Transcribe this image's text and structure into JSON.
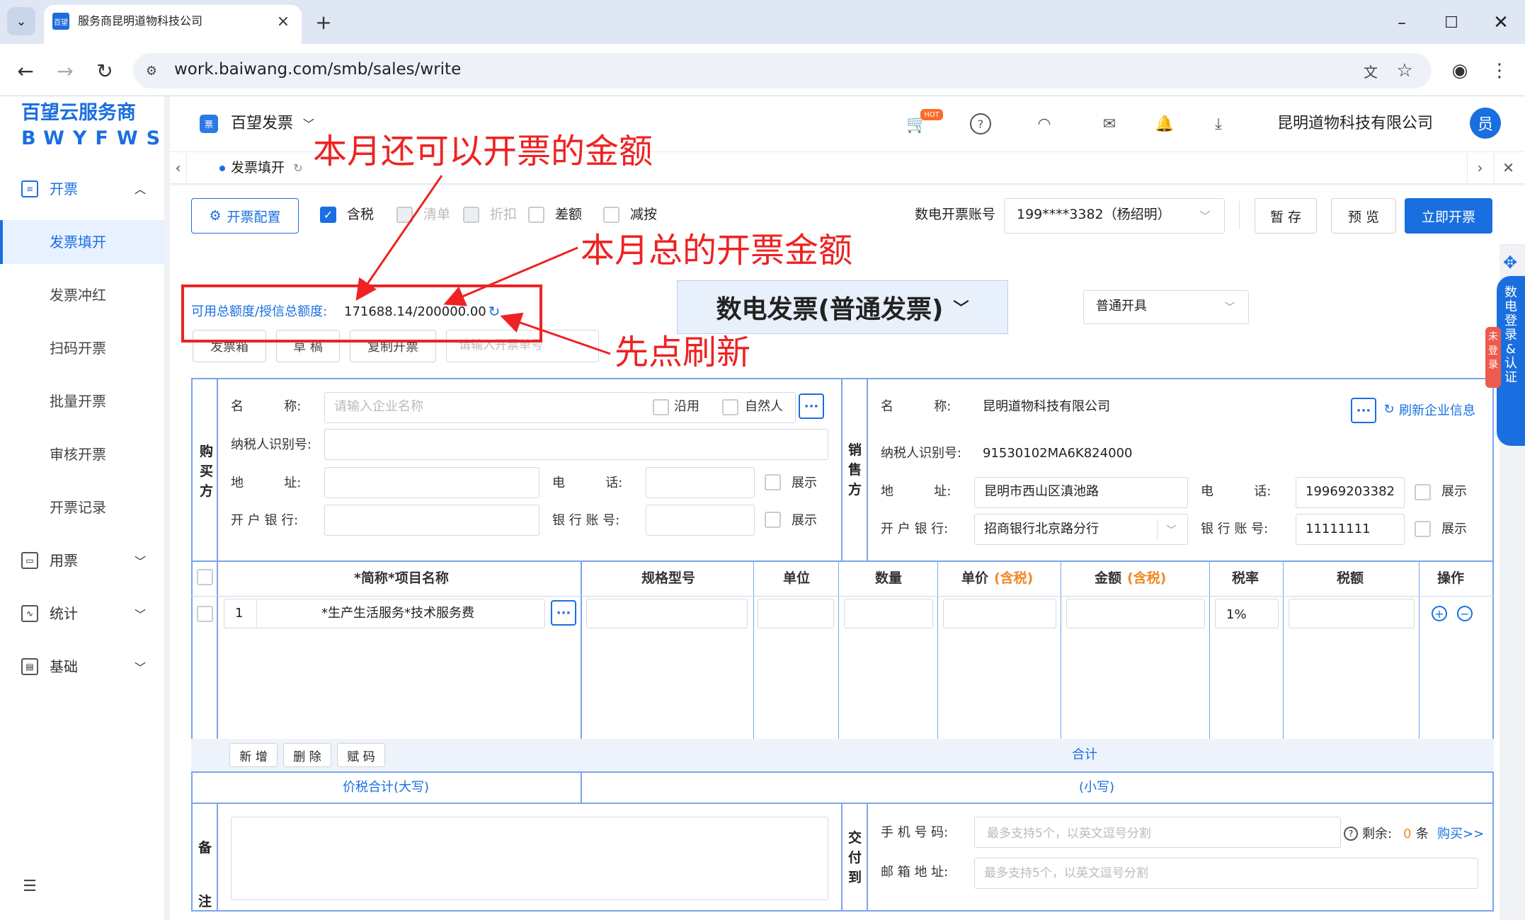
{
  "browser": {
    "tab_title": "服务商昆明道物科技公司",
    "tab_logo": "百望",
    "url": "work.baiwang.com/smb/sales/write"
  },
  "brand": {
    "line1": "百望云服务商",
    "line2": "BWYFWS"
  },
  "sidebar": {
    "items": [
      {
        "label": "开票",
        "icon": "invoice-icon"
      },
      {
        "label": "发票填开",
        "active": true
      },
      {
        "label": "发票冲红"
      },
      {
        "label": "扫码开票"
      },
      {
        "label": "批量开票"
      },
      {
        "label": "审核开票"
      },
      {
        "label": "开票记录"
      },
      {
        "label": "用票",
        "icon": "ticket-icon"
      },
      {
        "label": "统计",
        "icon": "chart-icon"
      },
      {
        "label": "基础",
        "icon": "base-icon"
      }
    ]
  },
  "header": {
    "app_name": "百望发票",
    "hot_badge": "HOT",
    "company": "昆明道物科技有限公司",
    "avatar": "员"
  },
  "page_tab": {
    "label": "发票填开"
  },
  "toolbar": {
    "config_label": "开票配置",
    "opt_tax": "含税",
    "opt_list": "清单",
    "opt_discount": "折扣",
    "opt_diff": "差额",
    "opt_reduce": "减按",
    "account_label": "数电开票账号",
    "account_value": "199****3382（杨绍明）",
    "save_label": "暂 存",
    "preview_label": "预 览",
    "issue_label": "立即开票"
  },
  "quota": {
    "label": "可用总额度/授信总额度:",
    "value": "171688.14/200000.00"
  },
  "invoice_type": {
    "title": "数电发票(普通发票)",
    "mode": "普通开具"
  },
  "sub_buttons": [
    "发票箱",
    "草 稿",
    "复制开票"
  ],
  "search_placeholder": "请输入开票单号",
  "buyer": {
    "side_label": "购买方",
    "name_label": "名          称:",
    "name_placeholder": "请输入企业名称",
    "reuse": "沿用",
    "natural": "自然人",
    "tax_label": "纳税人识别号:",
    "addr_label": "地          址:",
    "phone_label": "电          话:",
    "bank_label": "开 户 银 行:",
    "account_label": "银 行 账 号:",
    "show1": "展示",
    "show2": "展示"
  },
  "seller": {
    "side_label": "销售方",
    "name_label": "名          称:",
    "name": "昆明道物科技有限公司",
    "refresh": "刷新企业信息",
    "tax_label": "纳税人识别号:",
    "tax_id": "91530102MA6K824000",
    "addr_label": "地          址:",
    "addr": "昆明市西山区滇池路",
    "phone_label": "电          话:",
    "phone": "19969203382",
    "bank_label": "开 户 银 行:",
    "bank": "招商银行北京路分行",
    "account_label": "银 行 账 号:",
    "account": "11111111",
    "show1": "展示",
    "show2": "展示"
  },
  "table": {
    "headers": [
      "*简称*项目名称",
      "规格型号",
      "单位",
      "数量",
      "单价",
      "金额",
      "税率",
      "税额",
      "操作"
    ],
    "tax_incl": "(含税)",
    "row": {
      "index": "1",
      "name": "*生产生活服务*技术服务费",
      "rate": "1%"
    },
    "add": "新 增",
    "delete": "删 除",
    "code": "赋 码",
    "sum": "合计",
    "total_upper": "价税合计(大写)",
    "total_lower": "(小写)"
  },
  "remark": {
    "label": "备注"
  },
  "delivery": {
    "side_label": "交付到",
    "phone_label": "手 机 号 码:",
    "phone_placeholder": "最多支持5个，以英文逗号分割",
    "email_label": "邮 箱 地 址:",
    "email_placeholder": "最多支持5个，以英文逗号分割",
    "remain_label": "剩余:",
    "remain_count": "0",
    "remain_unit": "条",
    "buy": "购买>>"
  },
  "float_panel": {
    "text": "数电登录&认证",
    "badge": "未登录"
  },
  "annotations": {
    "a1": "本月还可以开票的金额",
    "a2": "本月总的开票金额",
    "a3": "先点刷新"
  }
}
